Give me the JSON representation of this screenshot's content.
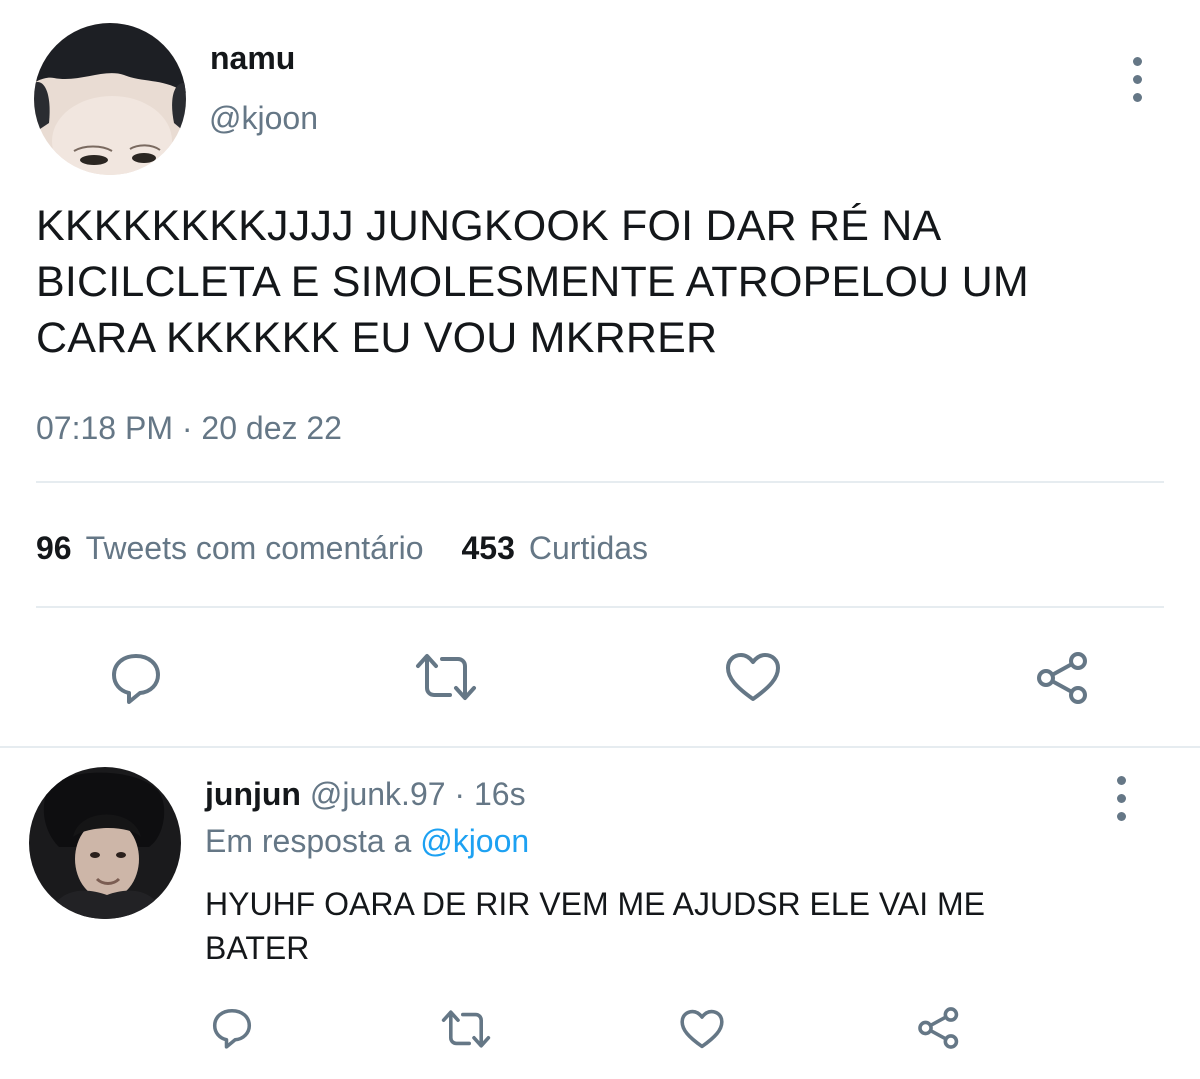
{
  "tweet": {
    "display_name": "namu",
    "handle": "@kjoon",
    "text_lines": [
      "KKKKKKKKJJJJ JUNGKOOK FOI DAR RÉ NA",
      "BICILCLETA E SIMOLESMENTE ATROPELOU UM",
      "CARA KKKKKK EU VOU MKRRER"
    ],
    "time": "07:18 PM",
    "separator": "·",
    "date": "20 dez 22",
    "stats": {
      "quotes_count": "96",
      "quotes_label": "Tweets com comentário",
      "likes_count": "453",
      "likes_label": "Curtidas"
    },
    "actions": [
      "reply-icon",
      "retweet-icon",
      "like-icon",
      "share-icon"
    ]
  },
  "reply": {
    "display_name": "junjun",
    "handle": "@junk.97",
    "separator": "·",
    "age": "16s",
    "in_reply_prefix": "Em resposta a",
    "in_reply_to": "@kjoon",
    "text_lines": [
      "HYUHF OARA DE RIR VEM ME AJUDSR ELE VAI ME",
      "BATER"
    ],
    "actions": [
      "reply-icon",
      "retweet-icon",
      "like-icon",
      "share-icon"
    ]
  },
  "colors": {
    "text_primary": "#14171a",
    "text_secondary": "#657786",
    "link": "#1da1f2",
    "divider": "#e6ecf0"
  }
}
